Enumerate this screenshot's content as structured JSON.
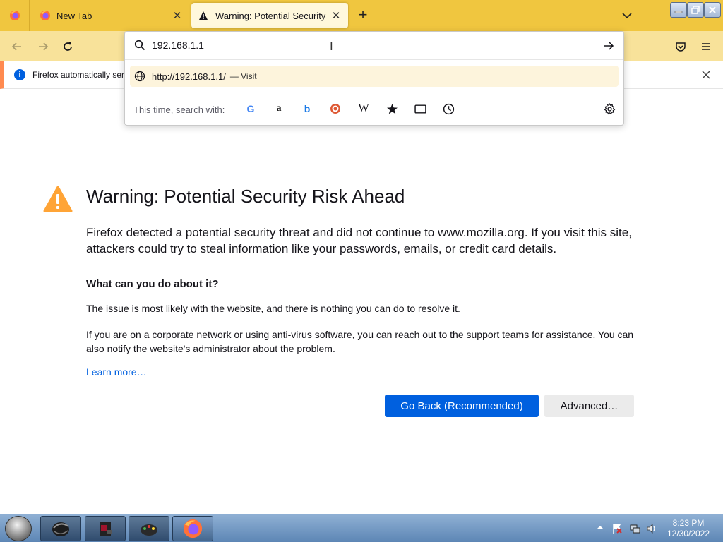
{
  "tabs": [
    {
      "title": ""
    },
    {
      "title": "New Tab",
      "close": "✕"
    },
    {
      "title": "Warning: Potential Security Risk Ahead",
      "close": "✕",
      "active": true
    }
  ],
  "new_tab_label": "+",
  "navbar": {
    "url_input_value": "192.168.1.1"
  },
  "infobar": {
    "icon": "i",
    "text": "Firefox automatically sen"
  },
  "url_dropdown": {
    "suggestion_url": "http://192.168.1.1/",
    "suggestion_action": "— Visit",
    "search_with_label": "This time, search with:",
    "engines": {
      "google": "G",
      "amazon": "a",
      "bing": "b",
      "wikipedia": "W"
    }
  },
  "error_page": {
    "title": "Warning: Potential Security Risk Ahead",
    "description": "Firefox detected a potential security threat and did not continue to www.mozilla.org. If you visit this site, attackers could try to steal information like your passwords, emails, or credit card details.",
    "what_heading": "What can you do about it?",
    "issue_text": "The issue is most likely with the website, and there is nothing you can do to resolve it.",
    "corporate_text": "If you are on a corporate network or using anti-virus software, you can reach out to the support teams for assistance. You can also notify the website's administrator about the problem.",
    "learn_more": "Learn more…",
    "go_back_label": "Go Back (Recommended)",
    "advanced_label": "Advanced…"
  },
  "taskbar": {
    "time": "8:23 PM",
    "date": "12/30/2022"
  },
  "colors": {
    "tabstrip": "#f0c63f",
    "navbar": "#f8e29a",
    "accent_blue": "#0060df",
    "warning_orange": "#ffa436",
    "infobar_border": "#ff8a50"
  }
}
